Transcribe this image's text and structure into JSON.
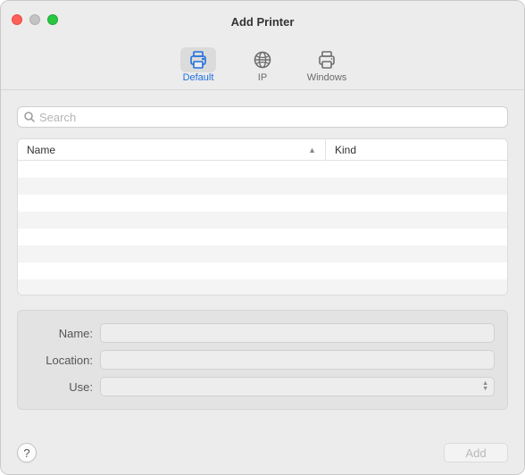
{
  "window": {
    "title": "Add Printer"
  },
  "toolbar": {
    "items": [
      {
        "label": "Default",
        "selected": true
      },
      {
        "label": "IP",
        "selected": false
      },
      {
        "label": "Windows",
        "selected": false
      }
    ]
  },
  "search": {
    "placeholder": "Search",
    "value": ""
  },
  "table": {
    "columns": {
      "name": "Name",
      "kind": "Kind"
    },
    "sort_column": "name",
    "sort_direction": "asc",
    "rows": []
  },
  "form": {
    "name_label": "Name:",
    "name_value": "",
    "location_label": "Location:",
    "location_value": "",
    "use_label": "Use:",
    "use_value": ""
  },
  "footer": {
    "help_label": "?",
    "add_label": "Add",
    "add_enabled": false
  }
}
